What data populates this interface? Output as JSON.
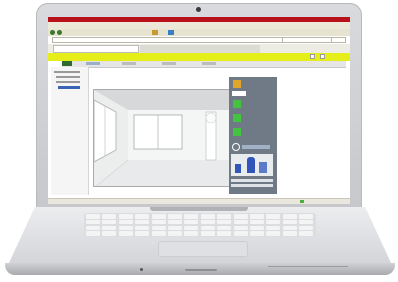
{
  "scene": {
    "device": "laptop",
    "screen": {
      "accent": "#e6ee1a",
      "titlebar_color": "#b8111a",
      "viewer_content": "room-panorama"
    }
  }
}
